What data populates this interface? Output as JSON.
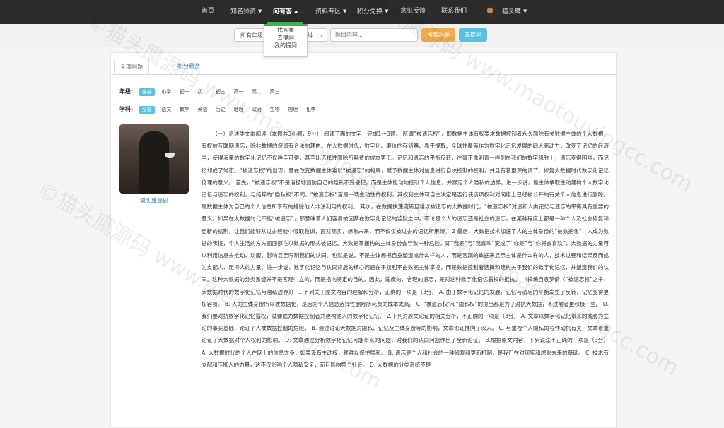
{
  "nav": {
    "items": [
      {
        "label": "首页"
      },
      {
        "label": "知名师资"
      },
      {
        "label": "问有答"
      },
      {
        "label": "资料专区"
      },
      {
        "label": "积分兑换"
      },
      {
        "label": "意见反馈"
      },
      {
        "label": "联系我们"
      }
    ],
    "user_name": "猫头鹰"
  },
  "dropdown": {
    "items": [
      "找答案",
      "去提问",
      "我的提问"
    ]
  },
  "search": {
    "grade_select": "所有年级",
    "subject_select": "科",
    "placeholder": "题目内容...",
    "search_button": "搜索问题",
    "ask_button": "去提问"
  },
  "tabs": {
    "all": "全部问题",
    "reward": "积分悬赏"
  },
  "filters": {
    "grade_label": "年级:",
    "grades": [
      "全部",
      "小学",
      "初一",
      "初二",
      "初三",
      "高一",
      "高二",
      "高三"
    ],
    "subject_label": "学科:",
    "subjects": [
      "全部",
      "语文",
      "数学",
      "英语",
      "历史",
      "地理",
      "政治",
      "生物",
      "物理",
      "化学"
    ]
  },
  "author": {
    "name": "猫头鹰源码"
  },
  "article": {
    "text": "（一）论述类文本阅读（本题共3小题，9分） 阅读下面的文字，完成1～3题。 所谓“被遗忘权”，即数据主体有权要求数据控制者永久删除有关数据主体的个人数据，有权被互联网遗忘，除非数据的保留有合法的理由。在大数据时代，数字化、廉价的存储器、易于提取、全球性覆盖作为数字化记忆发展的四大驱动力，改变了记忆的经济学，使得海量的数字化记忆不仅唾手可得，甚至比选择性删除所耗费的成本更低。记忆和遗忘的平衡反转，往事正像刺青一样刻在我们的数字肌肤上；遗忘变得困难，而记忆却成了常态。“被遗忘权”的出现，意在改变数据主体难以“被遗忘”的格局，赋予数据主体对信息进行自决控制的权利，并且有着更深的调节、修复大数据时代数字化记忆伦理的意义。 首先，“被遗忘权”不是消极地预防自己的隐私不受侵犯，而是主体能动地控制个人信息，并界定个人隐私的边界。进一步说，是主体争取主动建构个人数字化记忆与遗忘的权利，与纯粹的“隐私权”不同，“被遗忘权”首是一项主动性的权利，其权利主体可自主决定是否行使该项权利对网络上已经被公开的有关个人信息进行删除。是数据主体对自己的个人信息所享有的排除他人非法利用的权利。 其次，在数据快速流转且难以被遗忘的大数据时代，“被遗忘权”对遗和人类记忆与遗忘的平衡具有重要的意义。如果在大数据时代不能“被遗忘”，那意味着人们容易被固禁在数字化记忆的监狱之中，不论是个人的遗忘还是社会的遗忘，在某种程度上都是一种个人及社会修复和更新的机制，让我们能够从过去经验中吸取教训，面对现实，想象未来，而不仅仅被过去的记忆所束缚。 2 最后，大数据技术加速了人的主体身份的“被数据化”，人成为数据的表征，个人生活的方方面面都在以数据的形式被记忆。大数据掌握构的主体身份会导致一种危险，即“我是”与“我喜欢”变成了“你是”与“你将会喜欢”；大数据的力量可以利用信息去推动、劝服、影响甚至限制我们的认同。也就是说，不是主体想把自身塑造成什么样的人，而是客观的数据来显示主体是什么样的人，技术过程和结果反而成为支配人、压抑人的力量。进一步说，数字化记忆与认同背后的核心问题在于权利不由数据主体掌控，而是数据控制者选择和建构关于我们的数字化记忆，并塑造我们的认同。这种大数据的分类系统并不是客观中立的，而是指向特定的目的。因此，适度的、合理的遗忘，是对这种数字化记忆霸权的抵抗。 （摘编自袁梦倩《“被遗忘权”之争：大数据时代的数字化记忆与隐私边界》） 1.下列关于原文内容的理解和分析，正确的一项是（3分） A. 由于数字化记忆的发展，记忆与遗忘的平衡发生了反转，记忆变得更加容易。 B. 人的主体身份所以被数据化，是因为个人信息选择性删除所耗费的成本太高。 C. “被遗忘权”和“隐私权”的提出都是为了对抗大数据，不过前者更积极一些。 D. 我们要对抗数字化记忆霸权，就要成为数据控制者并建构他人的数字化记忆。 2.下列对原文论证的相关分析，不正确的一项是（3分） A. 文章以数字化记忆带来的威胁为立论的事实基础，论证了人被数据控制的危险。 B. 通过讨论大数据对隐私、记忆及主体身份等的影响，文章论证推向了深入。 C. 与重视个人隐私的写作动机有关，文章着重论证了大数据对个人权利的影响。 D. 文章通过分析数字化记忆可能带来的问题，对我们的认同问题作出了全新论证。 3.根据原文内容，下列说法不正确的一项是（3分） A. 大数据时代的个人在网上的信息太多，如果没有主动权，就难以保护隐私。 B. 遗忘是个人和社会的一种修复和更新机制，是我们在对现实和想象未来的基础。 C. 技术有支配和压抑人的力量，这不仅影响个人隐私安全，而且影响整个社会。 D. 大数据的分类系统不是"
  },
  "watermark": {
    "text": "©猫头鹰源码 www.maotouyingcc.com"
  },
  "colors": {
    "nav_bg": "#2b2b2b",
    "active_green": "#3fb34f",
    "search_btn": "#f0ad4e",
    "ask_btn": "#5bc0de",
    "link": "#337ab7"
  }
}
